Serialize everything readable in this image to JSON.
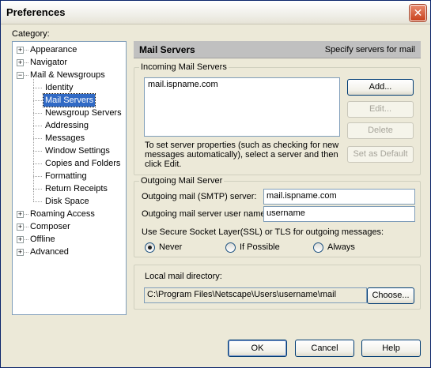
{
  "window": {
    "title": "Preferences",
    "close_glyph": "✕"
  },
  "category_label": "Category:",
  "tree": {
    "items": [
      {
        "label": "Appearance",
        "expander": "+"
      },
      {
        "label": "Navigator",
        "expander": "+"
      },
      {
        "label": "Mail & Newsgroups",
        "expander": "−"
      },
      {
        "label": "Identity"
      },
      {
        "label": "Mail Servers",
        "selected": true
      },
      {
        "label": "Newsgroup Servers"
      },
      {
        "label": "Addressing"
      },
      {
        "label": "Messages"
      },
      {
        "label": "Window Settings"
      },
      {
        "label": "Copies and Folders"
      },
      {
        "label": "Formatting"
      },
      {
        "label": "Return Receipts"
      },
      {
        "label": "Disk Space"
      },
      {
        "label": "Roaming Access",
        "expander": "+"
      },
      {
        "label": "Composer",
        "expander": "+"
      },
      {
        "label": "Offline",
        "expander": "+"
      },
      {
        "label": "Advanced",
        "expander": "+"
      }
    ]
  },
  "header": {
    "title": "Mail Servers",
    "description": "Specify servers for mail"
  },
  "incoming": {
    "legend": "Incoming Mail Servers",
    "servers": [
      "mail.ispname.com"
    ],
    "buttons": {
      "add": "Add...",
      "edit": "Edit...",
      "delete": "Delete",
      "set_default": "Set as Default"
    },
    "help_text": "To set server properties (such as checking for new messages automatically), select a server and then click Edit."
  },
  "outgoing": {
    "legend": "Outgoing Mail Server",
    "smtp_label": "Outgoing mail (SMTP) server:",
    "smtp_value": "mail.ispname.com",
    "user_label": "Outgoing mail server user name:",
    "user_value": "username",
    "ssl_label": "Use Secure Socket Layer(SSL) or TLS for outgoing messages:",
    "ssl_options": {
      "never": "Never",
      "if_possible": "If Possible",
      "always": "Always"
    },
    "ssl_selected": "never"
  },
  "local_dir": {
    "label": "Local mail directory:",
    "path": "C:\\Program Files\\Netscape\\Users\\username\\mail",
    "choose": "Choose..."
  },
  "footer": {
    "ok": "OK",
    "cancel": "Cancel",
    "help": "Help"
  }
}
